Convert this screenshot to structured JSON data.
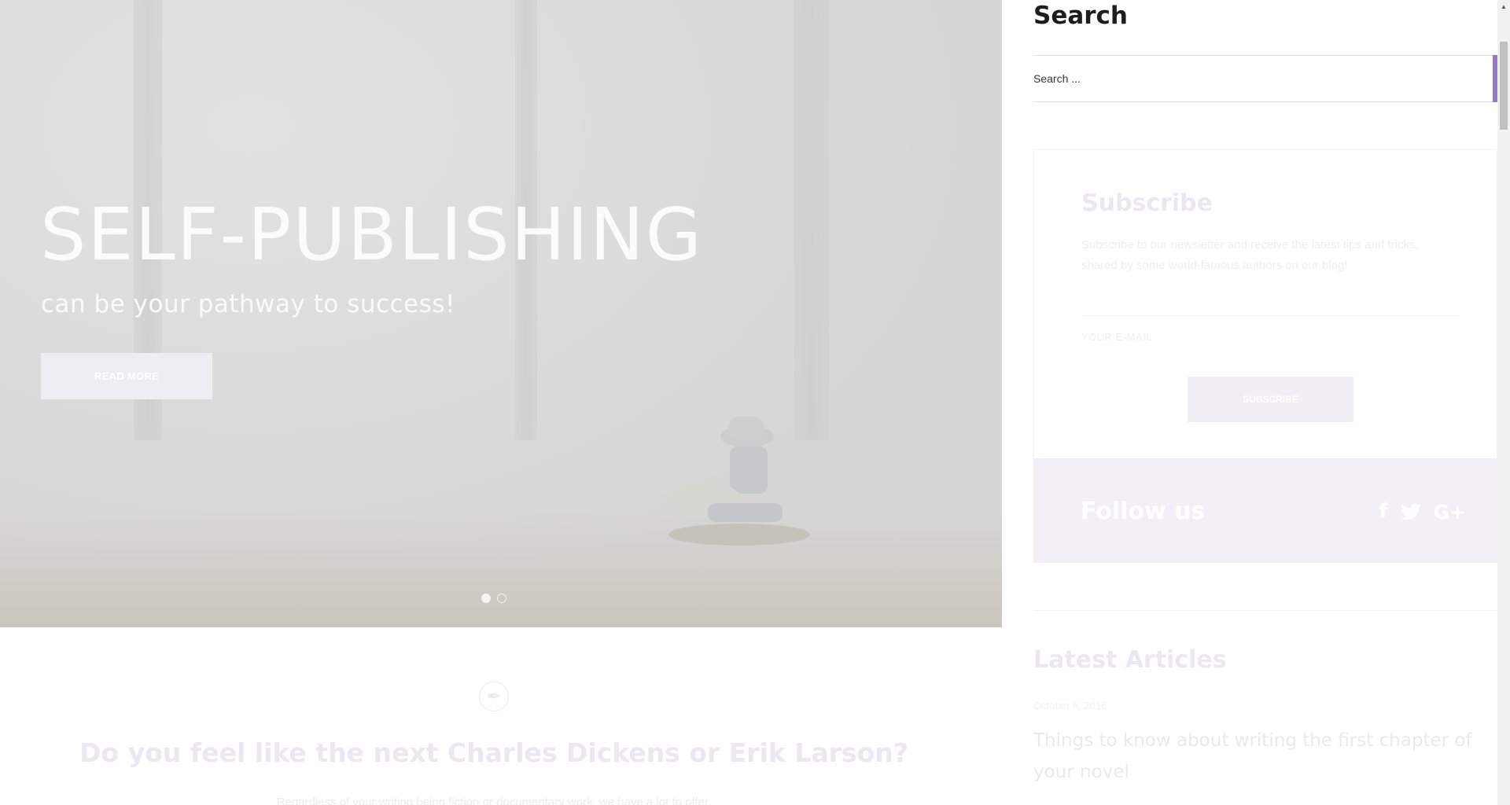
{
  "hero": {
    "title": "SELF-PUBLISHING",
    "subtitle": "can be your pathway to success!",
    "button_label": "READ MORE",
    "slides_count": 2,
    "active_slide": 1
  },
  "intro": {
    "icon": "pen-nib-icon",
    "heading": "Do you feel like the next Charles Dickens or Erik Larson?",
    "text": "Regardless of your writing being fiction or documentary work, we have a lot to offer."
  },
  "sidebar": {
    "search": {
      "title": "Search",
      "placeholder": "Search ...",
      "button_icon": "search-icon"
    },
    "subscribe": {
      "title": "Subscribe",
      "text": "Subscribe to our newsletter and receive the latest tips and tricks, shared by some world-famous authors on our blog!",
      "email_placeholder": "YOUR E-MAIL",
      "button_label": "SUBSCRIBE"
    },
    "follow": {
      "title": "Follow us",
      "icons": [
        "facebook-icon",
        "twitter-icon",
        "google-plus-icon"
      ]
    },
    "latest": {
      "title": "Latest Articles",
      "date": "October 6, 2016",
      "article_title": "Things to know about writing the first chapter of your novel"
    }
  },
  "colors": {
    "accent": "#9577c4",
    "follow_bg": "#f2f0f6"
  }
}
